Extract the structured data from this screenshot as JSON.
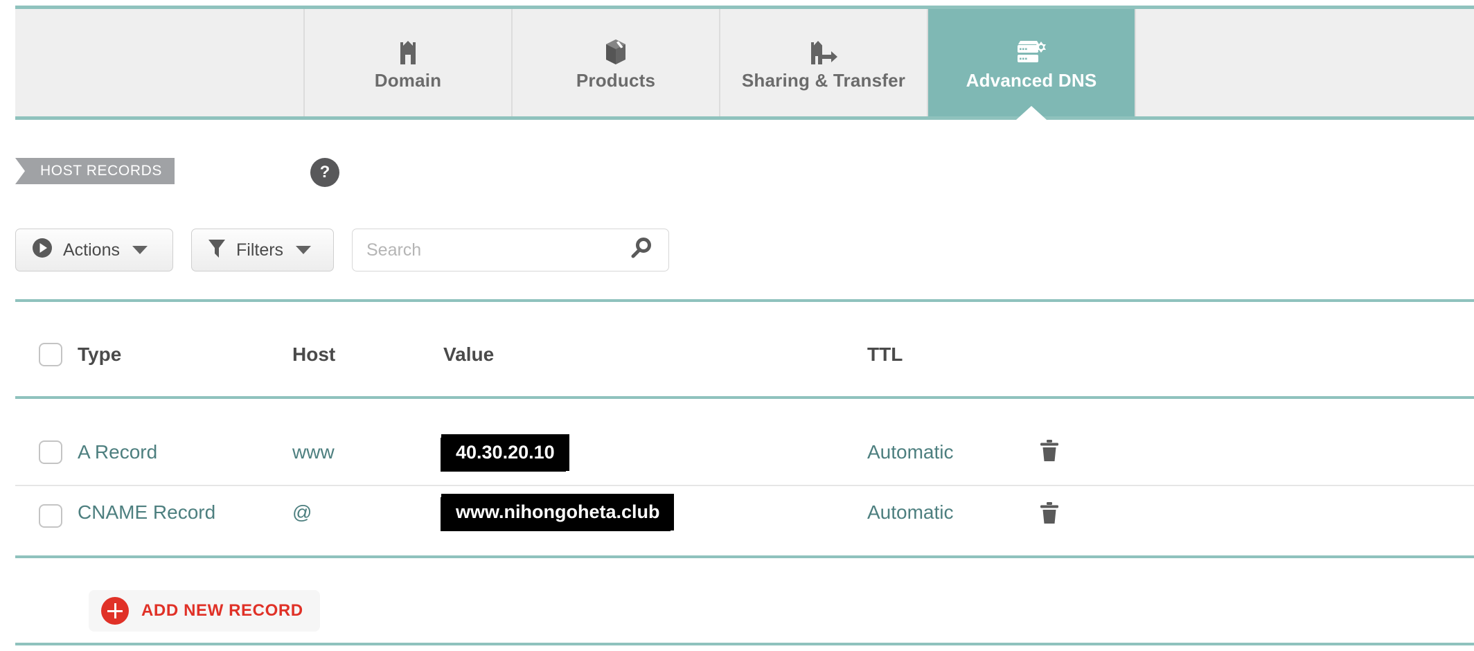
{
  "top_sliver_text": "",
  "colors": {
    "teal_accent": "#8fc2bd",
    "active_tab_bg": "#7fb8b4",
    "link_teal": "#4d7f7f",
    "banner_gray": "#a0a2a5",
    "add_record_red": "#e03127"
  },
  "tabs": [
    {
      "id": "domain",
      "label": "Domain",
      "icon": "house-icon",
      "active": false
    },
    {
      "id": "products",
      "label": "Products",
      "icon": "box-icon",
      "active": false
    },
    {
      "id": "sharing",
      "label": "Sharing & Transfer",
      "icon": "share-arrow-icon",
      "active": false
    },
    {
      "id": "dns",
      "label": "Advanced DNS",
      "icon": "server-gear-icon",
      "active": true
    }
  ],
  "section": {
    "banner_label": "HOST RECORDS",
    "help_label": "?"
  },
  "toolbar": {
    "actions_label": "Actions",
    "filters_label": "Filters",
    "search_placeholder": "Search",
    "search_value": ""
  },
  "table": {
    "columns": [
      "Type",
      "Host",
      "Value",
      "TTL"
    ],
    "rows": [
      {
        "type": "A Record",
        "host": "www",
        "value": "40.30.20.10",
        "value_redacted": true,
        "ttl": "Automatic",
        "delete_icon": "trash-icon"
      },
      {
        "type": "CNAME Record",
        "host": "@",
        "value": "www.nihongoheta.club",
        "value_redacted": true,
        "ttl": "Automatic",
        "delete_icon": "trash-icon"
      }
    ]
  },
  "footer": {
    "add_record_label": "ADD NEW RECORD"
  }
}
